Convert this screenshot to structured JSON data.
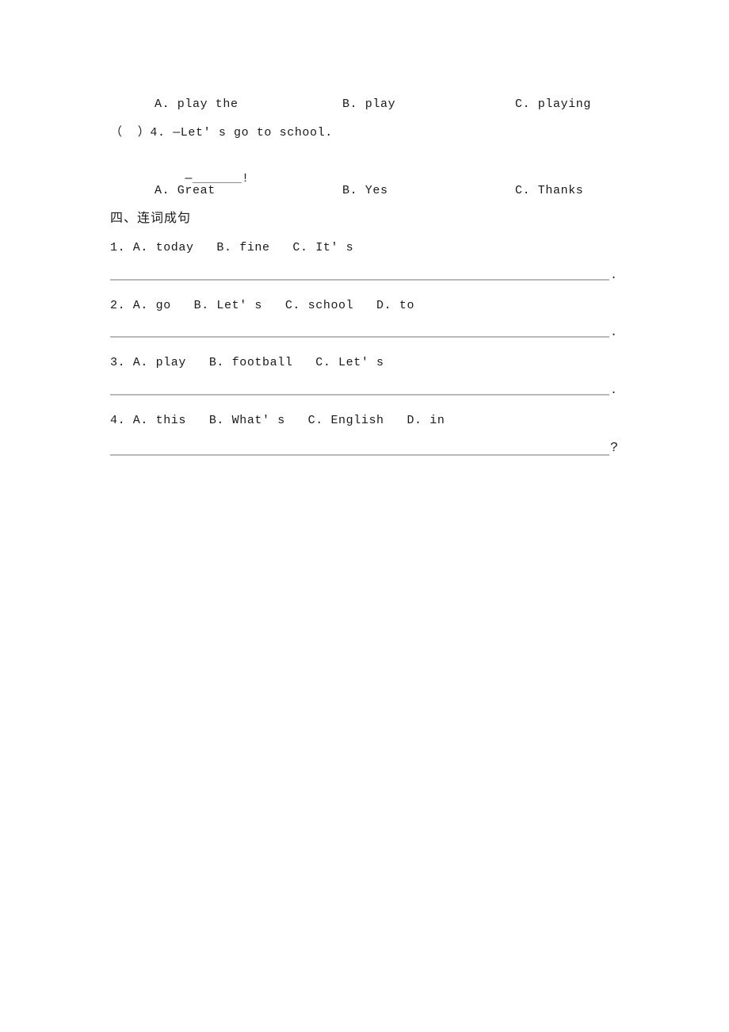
{
  "document": {
    "type": "worksheet-page",
    "page_background": "#ffffff",
    "text_color": "#1f1f1f",
    "rule_color": "#b9b9b9"
  },
  "carryover_question": {
    "options": {
      "a": "A. play the",
      "b": "B. play",
      "c": "C. playing"
    }
  },
  "question_4": {
    "marker": "（  ）4.",
    "stem": "（  ）4. —Let' s go to school.",
    "answer_prompt_dash": "—",
    "answer_prompt_end": "!",
    "options": {
      "a": "A. Great",
      "b": "B. Yes",
      "c": "C. Thanks"
    }
  },
  "section_four": {
    "heading": "四、连词成句",
    "items": [
      {
        "number": "1.",
        "prompt": "1. A. today   B. fine   C. It' s",
        "terminal_punctuation": "."
      },
      {
        "number": "2.",
        "prompt": "2. A. go   B. Let' s   C. school   D. to",
        "terminal_punctuation": "."
      },
      {
        "number": "3.",
        "prompt": "3. A. play   B. football   C. Let' s",
        "terminal_punctuation": "."
      },
      {
        "number": "4.",
        "prompt": "4. A. this   B. What' s   C. English   D. in",
        "terminal_punctuation": "?"
      }
    ]
  }
}
